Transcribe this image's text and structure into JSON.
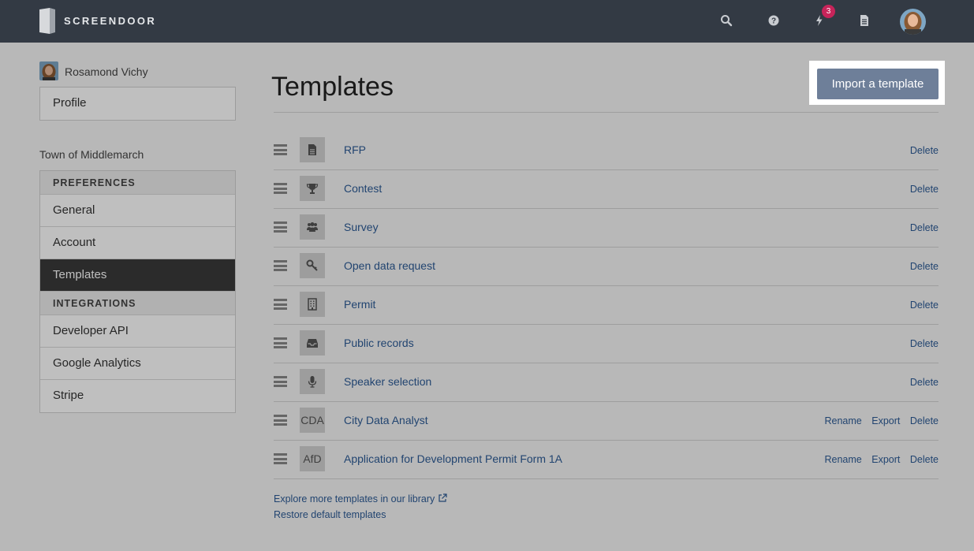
{
  "brand": {
    "name": "SCREENDOOR"
  },
  "topnav": {
    "notification_count": "3"
  },
  "user": {
    "name": "Rosamond Vichy"
  },
  "sidebar": {
    "profile_label": "Profile",
    "org_name": "Town of Middlemarch",
    "preferences_heading": "PREFERENCES",
    "preferences": [
      "General",
      "Account",
      "Templates"
    ],
    "integrations_heading": "INTEGRATIONS",
    "integrations": [
      "Developer API",
      "Google Analytics",
      "Stripe"
    ]
  },
  "main": {
    "title": "Templates",
    "import_label": "Import a template",
    "templates": [
      {
        "name": "RFP",
        "icon": "document-icon",
        "actions": [
          "Delete"
        ]
      },
      {
        "name": "Contest",
        "icon": "trophy-icon",
        "actions": [
          "Delete"
        ]
      },
      {
        "name": "Survey",
        "icon": "group-icon",
        "actions": [
          "Delete"
        ]
      },
      {
        "name": "Open data request",
        "icon": "key-icon",
        "actions": [
          "Delete"
        ]
      },
      {
        "name": "Permit",
        "icon": "building-icon",
        "actions": [
          "Delete"
        ]
      },
      {
        "name": "Public records",
        "icon": "inbox-icon",
        "actions": [
          "Delete"
        ]
      },
      {
        "name": "Speaker selection",
        "icon": "microphone-icon",
        "actions": [
          "Delete"
        ]
      },
      {
        "name": "City Data Analyst",
        "abbr": "CDA",
        "actions": [
          "Rename",
          "Export",
          "Delete"
        ]
      },
      {
        "name": "Application for Development Permit Form 1A",
        "abbr": "AfD",
        "actions": [
          "Rename",
          "Export",
          "Delete"
        ]
      }
    ],
    "explore_link": "Explore more templates in our library",
    "restore_link": "Restore default templates"
  },
  "colors": {
    "topbar": "#333a44",
    "link": "#2d5b96",
    "import_button": "#6e7f99",
    "badge": "#c7245a"
  }
}
